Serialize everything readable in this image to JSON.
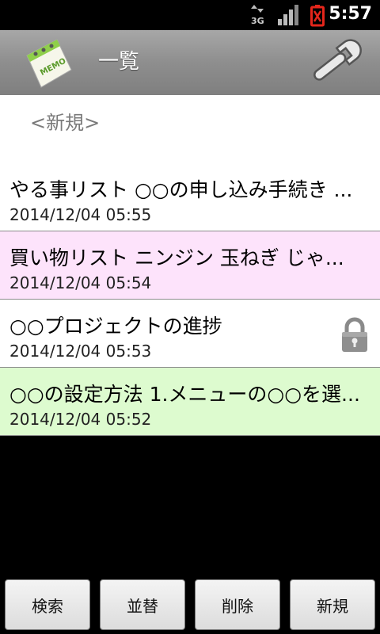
{
  "status": {
    "time": "5:57",
    "network": "3G"
  },
  "header": {
    "title": "一覧",
    "logo_text": "MEMO"
  },
  "new_entry": {
    "label": "<新規>"
  },
  "memos": [
    {
      "text": "やる事リスト ○○の申し込み手続き ...",
      "date": "2014/12/04 05:55",
      "bg": "#ffffff",
      "locked": false
    },
    {
      "text": "買い物リスト ニンジン 玉ねぎ じゃ...",
      "date": "2014/12/04 05:54",
      "bg": "#fde3fb",
      "locked": false
    },
    {
      "text": "○○プロジェクトの進捗",
      "date": "2014/12/04 05:53",
      "bg": "#ffffff",
      "locked": true
    },
    {
      "text": "○○の設定方法 1.メニューの○○を選...",
      "date": "2014/12/04 05:52",
      "bg": "#ddfbcf",
      "locked": false
    }
  ],
  "bottom_buttons": {
    "search": "検索",
    "sort": "並替",
    "delete": "削除",
    "new": "新規"
  },
  "colors": {
    "battery_alert": "#e5261b",
    "header_gray": "#8e8e8e"
  }
}
